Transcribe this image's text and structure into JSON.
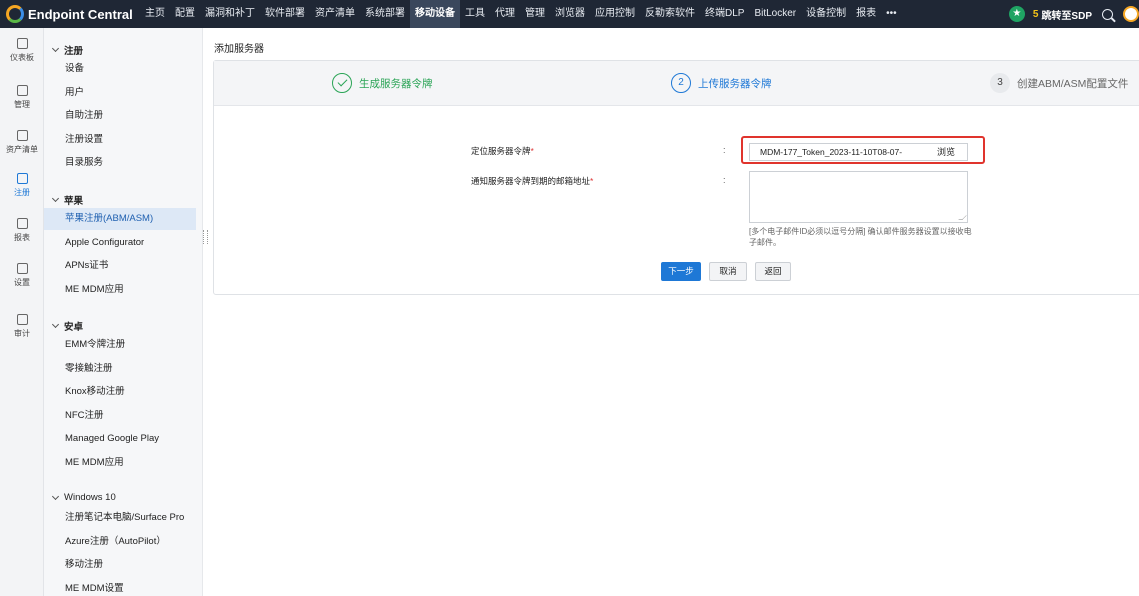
{
  "app": {
    "name": "Endpoint Central"
  },
  "topnav": {
    "items": [
      "主页",
      "配置",
      "漏洞和补丁",
      "软件部署",
      "资产清单",
      "系统部署",
      "移动设备",
      "工具",
      "代理",
      "管理",
      "浏览器",
      "应用控制",
      "反勒索软件",
      "终端DLP",
      "BitLocker",
      "设备控制",
      "报表",
      "•••"
    ],
    "active_index": 6,
    "sdp_label": "跳转至SDP"
  },
  "rail": {
    "items": [
      "仪表板",
      "管理",
      "资产清单",
      "注册",
      "报表",
      "设置",
      "审计"
    ],
    "active_index": 3
  },
  "sidebar": {
    "group_enroll": "注册",
    "enroll_items": [
      "设备",
      "用户",
      "自助注册",
      "注册设置",
      "目录服务"
    ],
    "group_apple": "苹果",
    "apple_items": [
      "苹果注册(ABM/ASM)",
      "Apple Configurator",
      "APNs证书",
      "ME MDM应用"
    ],
    "group_android": "安卓",
    "android_items": [
      "EMM令牌注册",
      "零接触注册",
      "Knox移动注册",
      "NFC注册",
      "Managed Google Play",
      "ME MDM应用"
    ],
    "group_windows": "Windows 10",
    "windows_items": [
      "注册笔记本电脑/Surface Pro",
      "Azure注册（AutoPilot）",
      "移动注册",
      "ME MDM设置"
    ]
  },
  "page": {
    "title": "添加服务器"
  },
  "steps": [
    {
      "number": "",
      "label": "生成服务器令牌",
      "state": "done"
    },
    {
      "number": "2",
      "label": "上传服务器令牌",
      "state": "current"
    },
    {
      "number": "3",
      "label": "创建ABM/ASM配置文件",
      "state": "pending"
    }
  ],
  "form": {
    "token_label": "定位服务器令牌",
    "token_file": "MDM-177_Token_2023-11-10T08-07-",
    "browse_label": "浏览",
    "email_label": "通知服务器令牌到期的邮箱地址",
    "email_value": "",
    "hint": "[多个电子邮件ID必须以逗号分隔] 确认邮件服务器设置以接收电子邮件。",
    "colon": ":",
    "required_mark": "*"
  },
  "buttons": {
    "next": "下一步",
    "cancel": "取消",
    "back": "返回"
  },
  "colors": {
    "topbar": "#1f2735",
    "accent": "#1e78d6",
    "success": "#2aa456",
    "highlight": "#e0342d"
  }
}
